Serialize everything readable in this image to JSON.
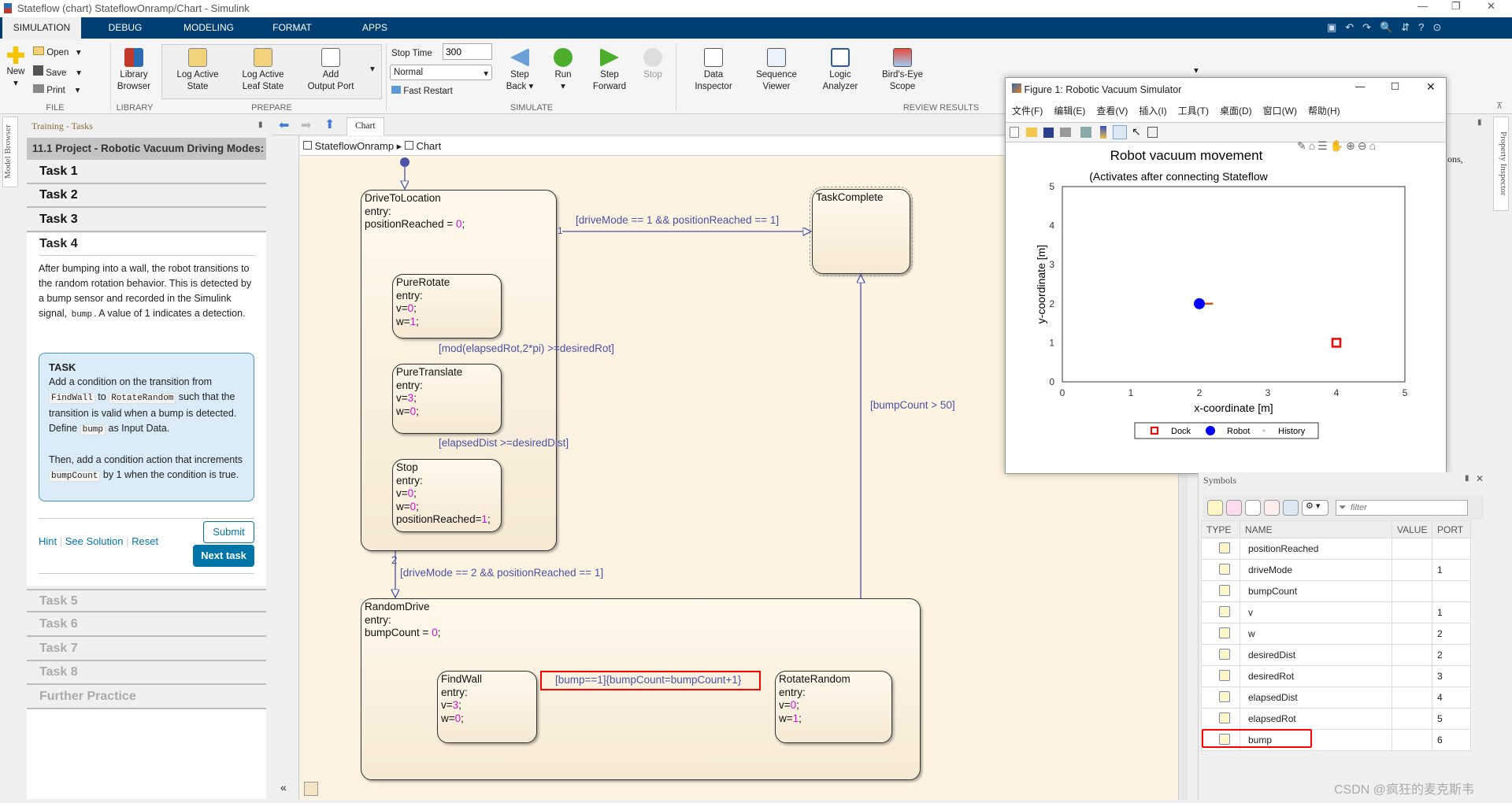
{
  "window": {
    "title": "Stateflow (chart) StateflowOnramp/Chart - Simulink"
  },
  "tabs": [
    "SIMULATION",
    "DEBUG",
    "MODELING",
    "FORMAT",
    "APPS"
  ],
  "ribbon": {
    "file": {
      "new": "New",
      "open": "Open",
      "save": "Save",
      "print": "Print",
      "group": "FILE"
    },
    "library": {
      "browser_1": "Library",
      "browser_2": "Browser",
      "group": "LIBRARY"
    },
    "prepare": {
      "log_active_state_1": "Log Active",
      "log_active_state_2": "State",
      "log_leaf_1": "Log Active",
      "log_leaf_2": "Leaf State",
      "add_output_1": "Add",
      "add_output_2": "Output Port",
      "group": "PREPARE"
    },
    "simulate": {
      "stop_time_label": "Stop Time",
      "stop_time_value": "300",
      "mode": "Normal",
      "fast_restart": "Fast Restart",
      "step_back_1": "Step",
      "step_back_2": "Back",
      "run": "Run",
      "step_forward_1": "Step",
      "step_forward_2": "Forward",
      "stop": "Stop",
      "group": "SIMULATE"
    },
    "review": {
      "data_inspector_1": "Data",
      "data_inspector_2": "Inspector",
      "sequence_1": "Sequence",
      "sequence_2": "Viewer",
      "logic_1": "Logic",
      "logic_2": "Analyzer",
      "birds_1": "Bird's-Eye",
      "birds_2": "Scope",
      "group": "REVIEW RESULTS"
    }
  },
  "side_tabs": {
    "model_browser": "Model Browser",
    "property_inspector": "Property Inspector"
  },
  "training": {
    "header": "Training - Tasks",
    "project": "11.1 Project - Robotic Vacuum Driving Modes:",
    "tasks_done": [
      "Task 1",
      "Task 2",
      "Task 3"
    ],
    "current": "Task 4",
    "description_1": "After bumping into a wall, the robot transitions to the random rotation behavior. This is detected by a bump sensor and recorded in the Simulink signal, ",
    "description_code": "bump",
    "description_2": ". A value of 1 indicates a detection.",
    "task_title": "TASK",
    "task_t1": "Add a condition on the transition from ",
    "task_c1": "FindWall",
    "task_t2": " to ",
    "task_c2": "RotateRandom",
    "task_t3": " such that the transition is valid when a bump is detected. Define ",
    "task_c3": "bump",
    "task_t4": " as Input Data.",
    "task_t5": "Then, add a condition action that increments ",
    "task_c4": "bumpCount",
    "task_t6": " by 1 when the condition is true.",
    "hint": "Hint",
    "see_solution": "See Solution",
    "reset": "Reset",
    "submit": "Submit",
    "next": "Next task",
    "tasks_locked": [
      "Task 5",
      "Task 6",
      "Task 7",
      "Task 8",
      "Further Practice"
    ],
    "accent": "#0076a8"
  },
  "editor": {
    "tab": "Chart",
    "breadcrumb": [
      "StateflowOnramp",
      "Chart"
    ]
  },
  "chart": {
    "states": {
      "drive": {
        "name": "DriveToLocation",
        "l1": "entry:",
        "l2": "positionReached = ",
        "v2": "0",
        ";": ";"
      },
      "rotate": {
        "name": "PureRotate",
        "l1": "entry:",
        "l2": "v=",
        "v2": "0",
        "l3": "w=",
        "v3": "1"
      },
      "translate": {
        "name": "PureTranslate",
        "l1": "entry:",
        "l2": "v=",
        "v2": "3",
        "l3": "w=",
        "v3": "0"
      },
      "stop": {
        "name": "Stop",
        "l1": "entry:",
        "l2": "v=",
        "v2": "0",
        "l3": "w=",
        "v3": "0",
        "l4": "positionReached=",
        "v4": "1"
      },
      "complete": {
        "name": "TaskComplete"
      },
      "random": {
        "name": "RandomDrive",
        "l1": "entry:",
        "l2": "bumpCount = ",
        "v2": "0"
      },
      "findwall": {
        "name": "FindWall",
        "l1": "entry:",
        "l2": "v=",
        "v2": "3",
        "l3": "w=",
        "v3": "0"
      },
      "rotrand": {
        "name": "RotateRandom",
        "l1": "entry:",
        "l2": "v=",
        "v2": "0",
        "l3": "w=",
        "v3": "1"
      }
    },
    "transitions": {
      "to_complete": "[driveMode == 1 && positionReached == 1]",
      "to_complete_order": "1",
      "rot_to_trans": "[mod(elapsedRot,2*pi) >=desiredRot]",
      "trans_to_stop": "[elapsedDist >=desiredDist]",
      "to_random": "[driveMode == 2 && positionReached == 1]",
      "to_random_order": "2",
      "random_to_complete": "[bumpCount > 50]",
      "find_to_rotate": "[bump==1]{bumpCount=bumpCount+1}"
    }
  },
  "figure": {
    "title": "Figure 1: Robotic Vacuum Simulator",
    "menu": [
      "文件(F)",
      "编辑(E)",
      "查看(V)",
      "插入(I)",
      "工具(T)",
      "桌面(D)",
      "窗口(W)",
      "帮助(H)"
    ]
  },
  "chart_data": {
    "type": "scatter",
    "title": "Robot vacuum movement",
    "subtitle": "(Activates after connecting Stateflow",
    "xlabel": "x-coordinate [m]",
    "ylabel": "y-coordinate [m]",
    "xlim": [
      0,
      5
    ],
    "ylim": [
      0,
      5
    ],
    "xticks": [
      "0",
      "1",
      "2",
      "3",
      "4",
      "5"
    ],
    "yticks": [
      "0",
      "1",
      "2",
      "3",
      "4",
      "5"
    ],
    "series": [
      {
        "name": "Dock",
        "marker": "square",
        "color": "#ff0000",
        "points": [
          [
            4,
            1
          ]
        ]
      },
      {
        "name": "Robot",
        "marker": "circle",
        "color": "#0000ff",
        "points": [
          [
            2,
            2
          ]
        ],
        "heading": [
          [
            2,
            2
          ],
          [
            2.2,
            2
          ]
        ],
        "heading_color": "#d95319"
      },
      {
        "name": "History",
        "marker": "dot",
        "color": "#bbbbbb",
        "points": []
      }
    ],
    "legend": "bottom-outside",
    "grid": false
  },
  "symbols": {
    "title": "Symbols",
    "filter_placeholder": "filter",
    "columns": [
      "TYPE",
      "NAME",
      "VALUE",
      "PORT"
    ],
    "rows": [
      {
        "name": "positionReached",
        "value": "",
        "port": ""
      },
      {
        "name": "driveMode",
        "value": "",
        "port": "1"
      },
      {
        "name": "bumpCount",
        "value": "",
        "port": ""
      },
      {
        "name": "v",
        "value": "",
        "port": "1"
      },
      {
        "name": "w",
        "value": "",
        "port": "2"
      },
      {
        "name": "desiredDist",
        "value": "",
        "port": "2"
      },
      {
        "name": "desiredRot",
        "value": "",
        "port": "3"
      },
      {
        "name": "elapsedDist",
        "value": "",
        "port": "4"
      },
      {
        "name": "elapsedRot",
        "value": "",
        "port": "5"
      },
      {
        "name": "bump",
        "value": "",
        "port": "6"
      }
    ]
  },
  "partial_text": "ons,",
  "watermark": "CSDN @疯狂的麦克斯韦",
  "highlight_color": "#ff0000"
}
